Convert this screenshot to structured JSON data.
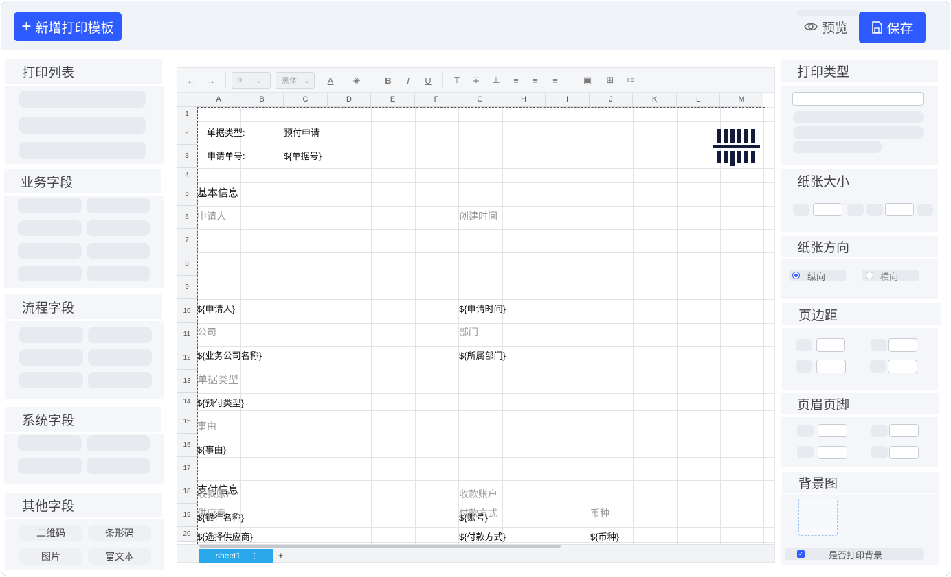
{
  "topbar": {
    "add_template_label": "新增打印模板",
    "preview_label": "预览",
    "save_label": "保存"
  },
  "left": {
    "print_list_title": "打印列表",
    "business_fields_title": "业务字段",
    "process_fields_title": "流程字段",
    "system_fields_title": "系统字段",
    "other_fields_title": "其他字段",
    "other_fields": [
      "二维码",
      "条形码",
      "图片",
      "富文本"
    ]
  },
  "sheet": {
    "font_size": "9",
    "font_family": "黑体",
    "columns": [
      "A",
      "B",
      "C",
      "D",
      "E",
      "F",
      "G",
      "H",
      "I",
      "J",
      "K",
      "L",
      "M"
    ],
    "rows": [
      "1",
      "2",
      "3",
      "4",
      "5",
      "6",
      "7",
      "8",
      "9",
      "10",
      "11",
      "12",
      "13",
      "14",
      "15",
      "16",
      "17",
      "18",
      "19",
      "20"
    ],
    "cells": {
      "doc_type_label": "单据类型:",
      "doc_type_value": "预付申请",
      "apply_no_label": "申请单号:",
      "apply_no_value": "${单据号}",
      "basic_info": "基本信息",
      "applicant_label": "申请人",
      "created_time_label": "创建时间",
      "applicant_value": "${申请人}",
      "apply_time_value": "${申请时间}",
      "company_label": "公司",
      "department_label": "部门",
      "company_value": "${业务公司名称}",
      "department_value": "${所属部门}",
      "doc_type_label2": "单据类型",
      "prepay_type_value": "${预付类型}",
      "reason_label": "事由",
      "reason_value": "${事由}",
      "payment_info": "支付信息",
      "supplier_label": "供应商",
      "pay_method_label": "付款方式",
      "currency_label": "币种",
      "supplier_value": "${选择供应商}",
      "pay_method_value": "${付款方式}",
      "currency_value": "${币种}",
      "account_label": "收款账户",
      "account_label2": "收款账户",
      "bank_value": "${银行名称}",
      "account_value": "${账号}"
    },
    "sheet_tab": "sheet1",
    "add_sheet": "+"
  },
  "right": {
    "print_type_title": "打印类型",
    "paper_size_title": "纸张大小",
    "paper_orientation_title": "纸张方向",
    "portrait_label": "纵向",
    "landscape_label": "横向",
    "margin_title": "页边距",
    "header_footer_title": "页眉页脚",
    "background_title": "背景图",
    "upload_plus": "+",
    "print_background_label": "是否打印背景"
  },
  "colors": {
    "primary": "#2e5bff",
    "panel": "#f4f6fa",
    "sheet_tab": "#29a9ec"
  }
}
